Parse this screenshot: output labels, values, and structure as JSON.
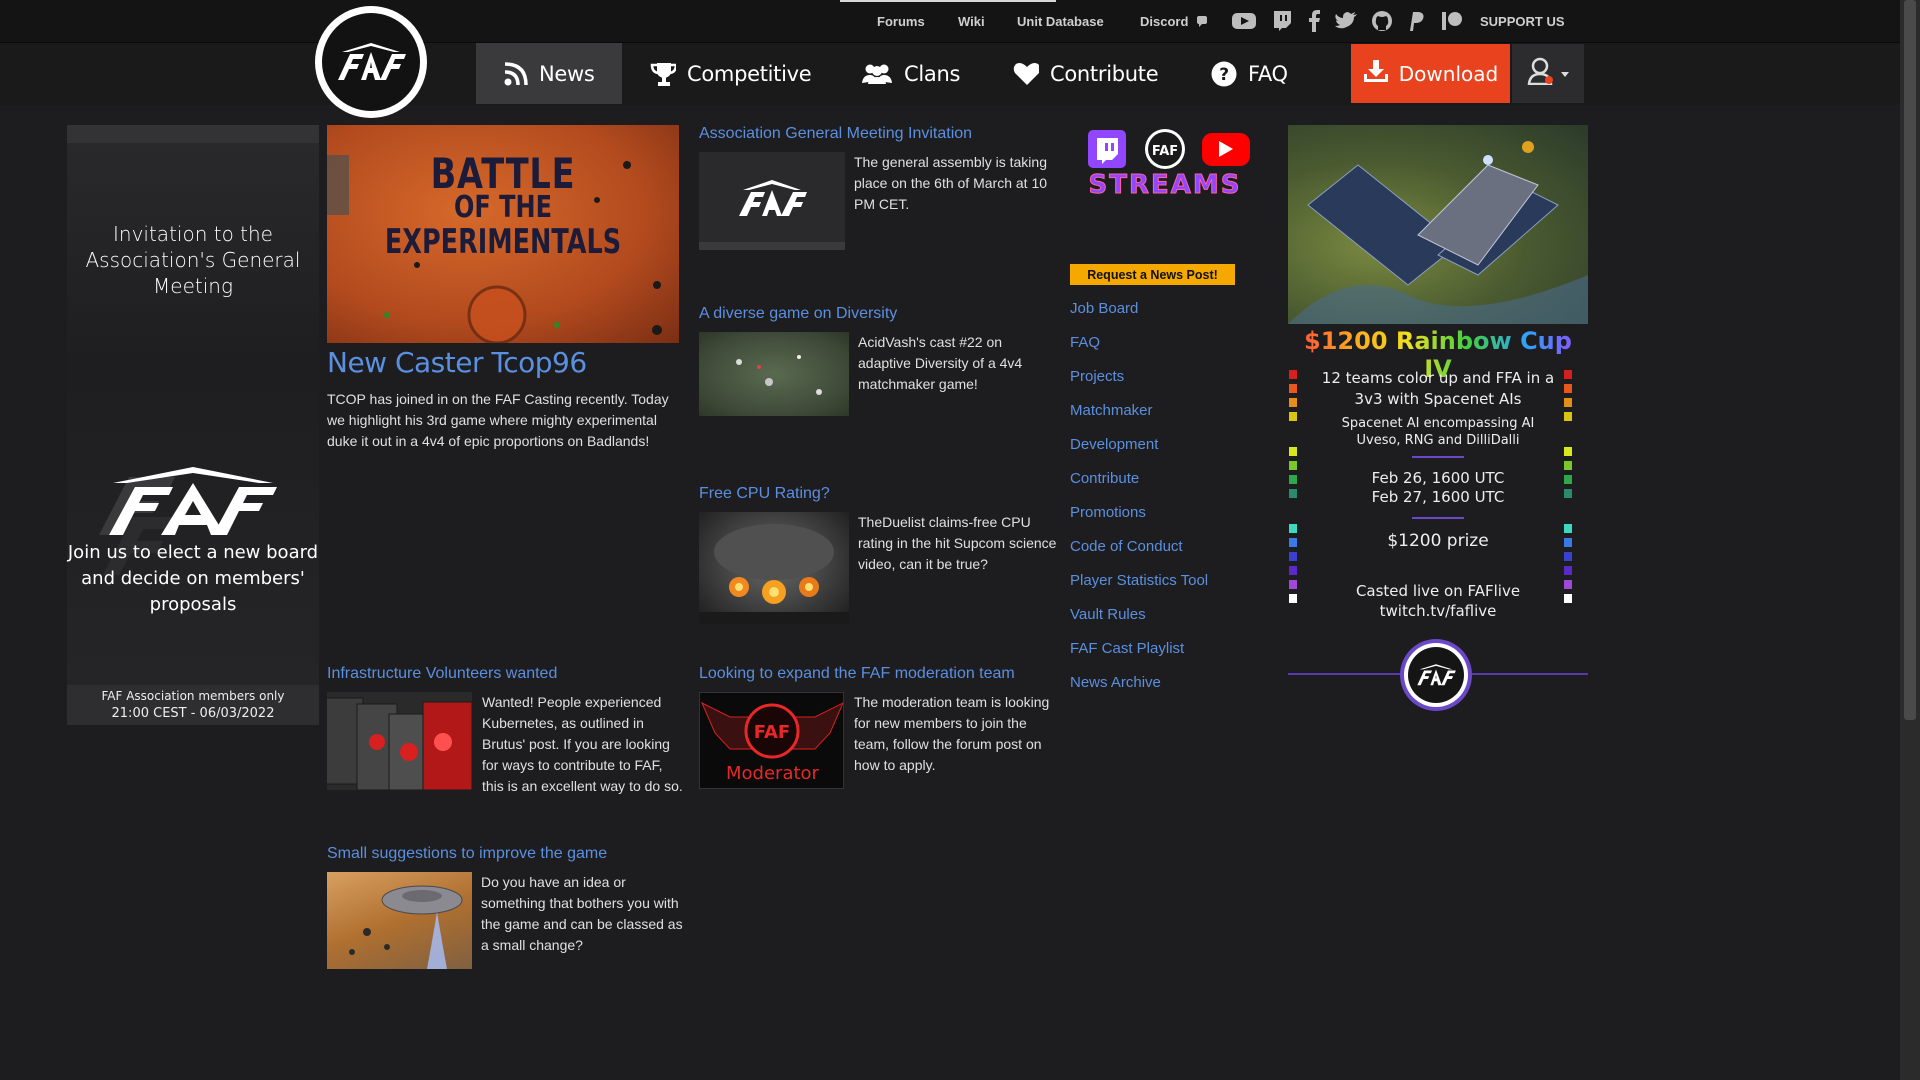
{
  "topbar": {
    "links": [
      "Forums",
      "Wiki",
      "Unit Database",
      "Discord"
    ],
    "support": "SUPPORT US",
    "icons": [
      "youtube-icon",
      "twitch-icon",
      "facebook-icon",
      "twitter-icon",
      "github-icon",
      "paypal-icon",
      "patreon-icon"
    ]
  },
  "nav": {
    "items": [
      "News",
      "Competitive",
      "Clans",
      "Contribute",
      "FAQ"
    ],
    "download": "Download"
  },
  "left_banner": {
    "title": "Invitation to the Association's General Meeting",
    "subtitle": "Join us to elect a new board and decide on members' proposals",
    "footer_line1": "FAF Association members only",
    "footer_line2": "21:00 CEST - 06/03/2022"
  },
  "featured": {
    "image_text_1": "BATTLE",
    "image_text_2": "OF THE",
    "image_text_3": "EXPERIMENTALS",
    "title": "New Caster Tcop96",
    "excerpt": "TCOP has joined in on the FAF Casting recently. Today we highlight his 3rd game where mighty experimental duke it out in a 4v4 of epic proportions on Badlands!"
  },
  "news": [
    {
      "title": "Association General Meeting Invitation",
      "excerpt": "The general assembly is taking place on the 6th of March at 10 PM CET."
    },
    {
      "title": "A diverse game on Diversity",
      "excerpt": "AcidVash's cast #22 on adaptive Diversity of a 4v4 matchmaker game!"
    },
    {
      "title": "Free CPU Rating?",
      "excerpt": "TheDuelist claims-free CPU rating in the hit Supcom science video, can it be true?"
    },
    {
      "title": "Infrastructure Volunteers wanted",
      "excerpt": "Wanted! People experienced Kubernetes, as outlined in Brutus' post. If you are looking for ways to contribute to FAF, this is an excellent way to do so."
    },
    {
      "title": "Looking to expand the FAF moderation team",
      "excerpt": "The moderation team is looking for new members to join the team, follow the forum post on how to apply.",
      "image_label": "Moderator"
    },
    {
      "title": "Small suggestions to improve the game",
      "excerpt": "Do you have an idea or something that bothers you with the game and can be classed as a small change?"
    }
  ],
  "sidebar": {
    "streams_label": "STREAMS",
    "request_button": "Request a News Post!",
    "links": [
      "Job Board",
      "FAQ",
      "Projects",
      "Matchmaker",
      "Development",
      "Contribute",
      "Promotions",
      "Code of Conduct",
      "Player Statistics Tool",
      "Vault Rules",
      "FAF Cast Playlist",
      "News Archive"
    ]
  },
  "tournament": {
    "title": "$1200 Rainbow Cup IV",
    "line1": "12 teams color up and FFA in a 3v3 with Spacenet AIs",
    "line2": "Spacenet AI encompassing AI Uveso, RNG and DilliDalli",
    "date1": "Feb 26, 1600 UTC",
    "date2": "Feb 27, 1600 UTC",
    "prize": "$1200 prize",
    "cast1": "Casted live on FAFlive",
    "cast2": "twitch.tv/faflive",
    "dot_colors": [
      "#d62020",
      "#e8581c",
      "#e58e1a",
      "#d8c414",
      "#d8e81e",
      "#7ac82a",
      "#2ea84a",
      "#2a8a6a",
      "#3cd8c0",
      "#3a7ae8",
      "#3a40d0",
      "#5a2ac8",
      "#a048d8",
      "#ffffff"
    ]
  }
}
